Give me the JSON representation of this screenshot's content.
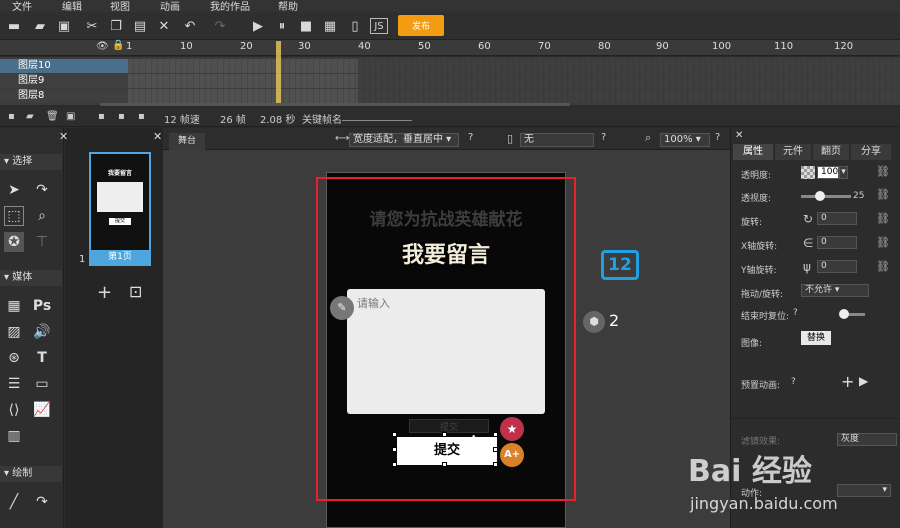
{
  "menu": [
    "文件",
    "编辑",
    "视图",
    "动画",
    "我的作品",
    "帮助"
  ],
  "toolbar": {
    "publish_label": "发布",
    "icons": [
      "new-icon",
      "open-icon",
      "save-icon",
      "cut-icon",
      "copy-icon",
      "paste-icon",
      "delete-icon",
      "undo-icon",
      "redo-icon",
      "play-icon",
      "pause-icon",
      "stop-icon",
      "qrcode-icon",
      "js-icon"
    ]
  },
  "timeline": {
    "ruler": [
      "1",
      "10",
      "20",
      "30",
      "40",
      "50",
      "60",
      "70",
      "80",
      "90",
      "100",
      "110",
      "120"
    ],
    "layers": [
      "图层10",
      "图层9",
      "图层8"
    ],
    "status": {
      "fps": "12 帧速",
      "frames": "26 帧",
      "seconds": "2.08 秒",
      "keyframe_label": "关键帧名"
    }
  },
  "tools": {
    "sections": [
      "选择",
      "媒体",
      "绘制"
    ]
  },
  "pages": {
    "thumb_title": "我要留言",
    "thumb_btn": "提交",
    "page_label": "第1页",
    "page_number": "1"
  },
  "stage": {
    "tab": "舞台",
    "fit_select": "宽度适配，垂直居中",
    "device_select": "无",
    "zoom": "100%",
    "headline_faded": "请您为抗战英雄献花",
    "headline": "我要留言",
    "textarea_placeholder": "请输入",
    "submit_label": "提交",
    "ghost_button": "提交",
    "page_badge": "12",
    "cube_number": "2"
  },
  "properties": {
    "tabs": [
      "属性",
      "元件",
      "翻页",
      "分享"
    ],
    "opacity_label": "透明度:",
    "opacity_value": "100",
    "transparency_label": "透视度:",
    "transparency_value": 25,
    "rotate_label": "旋转:",
    "rotate_value": "0",
    "xrot_label": "X轴旋转:",
    "xrot_value": "0",
    "yrot_label": "Y轴旋转:",
    "yrot_value": "0",
    "drag_label": "拖动/旋转:",
    "drag_value": "不允许",
    "reset_label": "结束时复位:",
    "image_label": "图像:",
    "replace_btn": "替换",
    "preset_anim_label": "预置动画:",
    "filter_value": "灰度",
    "filter_label": "滤镜效果:",
    "bottom_label": "动作:"
  },
  "colors": {
    "accent": "#f39c12",
    "selection": "#4ea6dc",
    "red_frame": "#e8212a"
  },
  "watermark": {
    "line1": "Bai 经验",
    "line2": "jingyan.baidu.com"
  }
}
